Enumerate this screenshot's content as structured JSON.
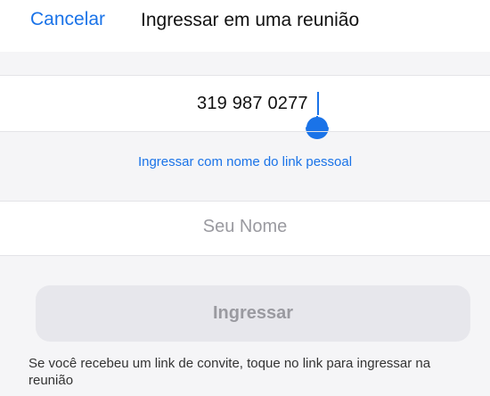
{
  "header": {
    "cancel_label": "Cancelar",
    "title": "Ingressar em uma reunião"
  },
  "meeting": {
    "id_value": "319 987 0277"
  },
  "personal_link": {
    "label": "Ingressar com nome do link pessoal"
  },
  "name_field": {
    "placeholder": "Seu Nome",
    "value": ""
  },
  "join_button": {
    "label": "Ingressar",
    "enabled": false
  },
  "hint": {
    "text": "Se você recebeu um link de convite, toque no link para ingressar na reunião"
  },
  "colors": {
    "accent": "#1a73e8",
    "background": "#f5f5f7",
    "button_disabled_bg": "#e7e7ec",
    "button_disabled_text": "#9a9aa0"
  }
}
